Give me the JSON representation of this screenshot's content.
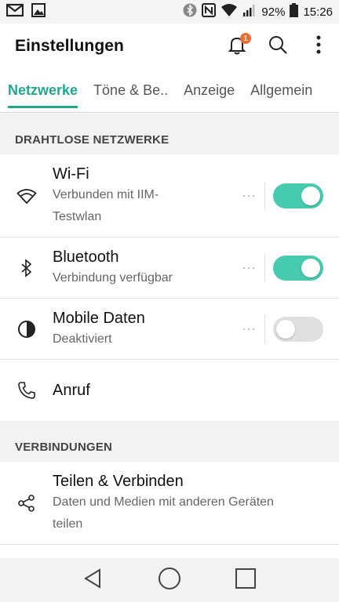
{
  "status_bar": {
    "battery_percent": "92%",
    "time": "15:26",
    "icons": [
      "gmail-icon",
      "gallery-icon",
      "bluetooth-icon",
      "nfc-icon",
      "wifi-icon",
      "signal-icon",
      "battery-icon"
    ]
  },
  "app_bar": {
    "title": "Einstellungen",
    "notification_badge": "1",
    "icons": [
      "notification-bell-icon",
      "search-icon",
      "overflow-menu-icon"
    ]
  },
  "tabs": [
    {
      "label": "Netzwerke",
      "active": true
    },
    {
      "label": "Töne & Be..",
      "active": false
    },
    {
      "label": "Anzeige",
      "active": false
    },
    {
      "label": "Allgemein",
      "active": false
    }
  ],
  "sections": {
    "wireless": {
      "header": "DRAHTLOSE NETZWERKE",
      "items": [
        {
          "title": "Wi-Fi",
          "subtitle_line1": "Verbunden mit IIM-",
          "subtitle_line2": "Testwlan",
          "toggle": "on",
          "icon": "wifi-icon"
        },
        {
          "title": "Bluetooth",
          "subtitle": "Verbindung verfügbar",
          "toggle": "on",
          "icon": "bluetooth-icon"
        },
        {
          "title": "Mobile Daten",
          "subtitle": "Deaktiviert",
          "toggle": "off",
          "icon": "mobile-data-icon"
        },
        {
          "title": "Anruf",
          "icon": "phone-icon"
        }
      ]
    },
    "connections": {
      "header": "VERBINDUNGEN",
      "items": [
        {
          "title": "Teilen & Verbinden",
          "subtitle_line1": "Daten und Medien mit anderen Geräten",
          "subtitle_line2": "teilen",
          "icon": "share-icon"
        }
      ]
    }
  },
  "nav_bar": {
    "icons": [
      "back-icon",
      "home-icon",
      "recents-icon"
    ]
  },
  "colors": {
    "accent": "#22a58d",
    "toggle_on": "#46cbb0",
    "badge": "#ee6b2e"
  }
}
